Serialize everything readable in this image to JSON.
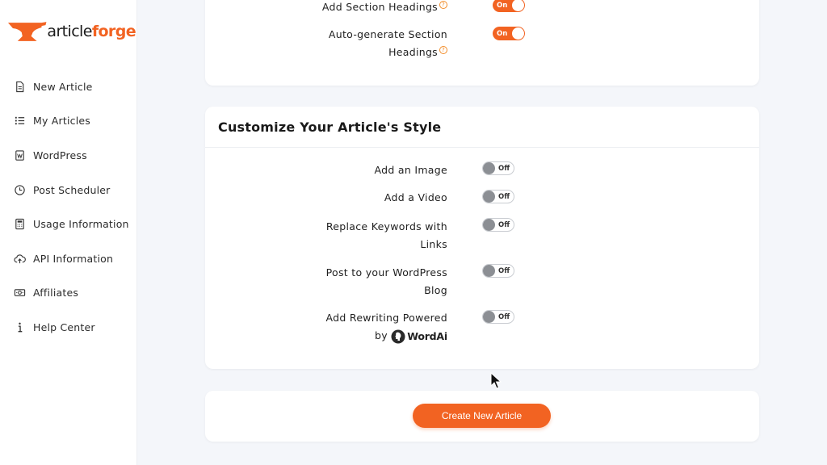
{
  "brand": {
    "logo_part1": "article",
    "logo_part2": "forge",
    "accent_color": "#f26322"
  },
  "sidebar": {
    "items": [
      {
        "label": "New Article",
        "icon": "document-icon"
      },
      {
        "label": "My Articles",
        "icon": "list-icon"
      },
      {
        "label": "WordPress",
        "icon": "wordpress-icon"
      },
      {
        "label": "Post Scheduler",
        "icon": "clock-icon"
      },
      {
        "label": "Usage Information",
        "icon": "calculator-icon"
      },
      {
        "label": "API Information",
        "icon": "cloud-upload-icon"
      },
      {
        "label": "Affiliates",
        "icon": "money-icon"
      },
      {
        "label": "Help Center",
        "icon": "info-icon"
      }
    ]
  },
  "headings_section": {
    "add_section_headings": {
      "label": "Add Section Headings",
      "state": "On"
    },
    "auto_generate": {
      "label_line1": "Auto-generate Section",
      "label_line2": "Headings",
      "state": "On"
    }
  },
  "style_section": {
    "title": "Customize Your Article's Style",
    "options": [
      {
        "label_line1": "Add an Image",
        "label_line2": "",
        "state": "Off"
      },
      {
        "label_line1": "Add a Video",
        "label_line2": "",
        "state": "Off"
      },
      {
        "label_line1": "Replace Keywords with",
        "label_line2": "Links",
        "state": "Off"
      },
      {
        "label_line1": "Post to your WordPress",
        "label_line2": "Blog",
        "state": "Off"
      },
      {
        "label_line1": "Add Rewriting Powered",
        "label_line2": "by",
        "state": "Off"
      }
    ],
    "wordai_brand": "WordAi"
  },
  "actions": {
    "create_label": "Create New Article"
  }
}
